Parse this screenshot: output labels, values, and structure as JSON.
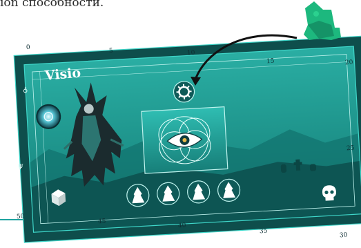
{
  "caption": {
    "text": "ion способности."
  },
  "board": {
    "title": "Visio",
    "track": [
      {
        "value": "0"
      },
      {
        "value": "5"
      },
      {
        "value": "10"
      },
      {
        "value": "15"
      },
      {
        "value": "20"
      },
      {
        "value": "25"
      },
      {
        "value": "30"
      },
      {
        "value": "35"
      },
      {
        "value": "40"
      },
      {
        "value": "45"
      },
      {
        "value": "50"
      }
    ],
    "side_symbols": {
      "top": "♁",
      "bottom": "Ψ"
    },
    "icons": {
      "ability": "sun-gear-icon",
      "central": "all-seeing-eye-icon",
      "skull": "skull-icon",
      "cube": "cube-icon",
      "orb": "crystal-orb-icon",
      "pieces": [
        "wizard-pawn-icon",
        "wizard-pawn-icon",
        "wizard-pawn-icon",
        "wizard-pawn-icon"
      ]
    }
  },
  "colors": {
    "board": "#1f9e95",
    "board_dark": "#0c4a48",
    "frame": "#2ed0c4",
    "token": "#1db87e",
    "arrow": "#111111"
  }
}
